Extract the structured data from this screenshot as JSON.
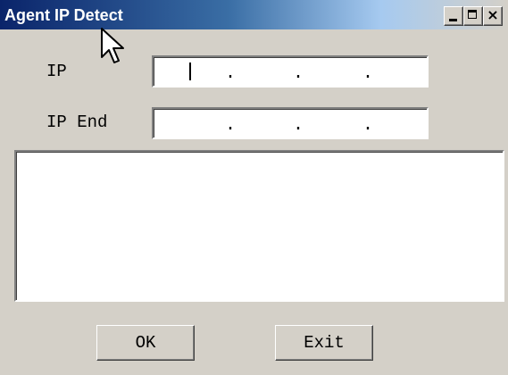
{
  "window": {
    "title": "Agent IP Detect",
    "controls": {
      "minimize": "minimize-icon",
      "maximize": "maximize-icon",
      "close": "close-icon",
      "close_glyph": "×"
    }
  },
  "form": {
    "ip_label": "IP",
    "ip_end_label": "IP End",
    "ip_value": [
      "",
      "",
      "",
      ""
    ],
    "ip_end_value": [
      "",
      "",
      "",
      ""
    ],
    "separator": "."
  },
  "buttons": {
    "ok": "OK",
    "exit": "Exit"
  },
  "colors": {
    "titlebar_start": "#0a246a",
    "face": "#d4d0c8",
    "field": "#ffffff"
  }
}
